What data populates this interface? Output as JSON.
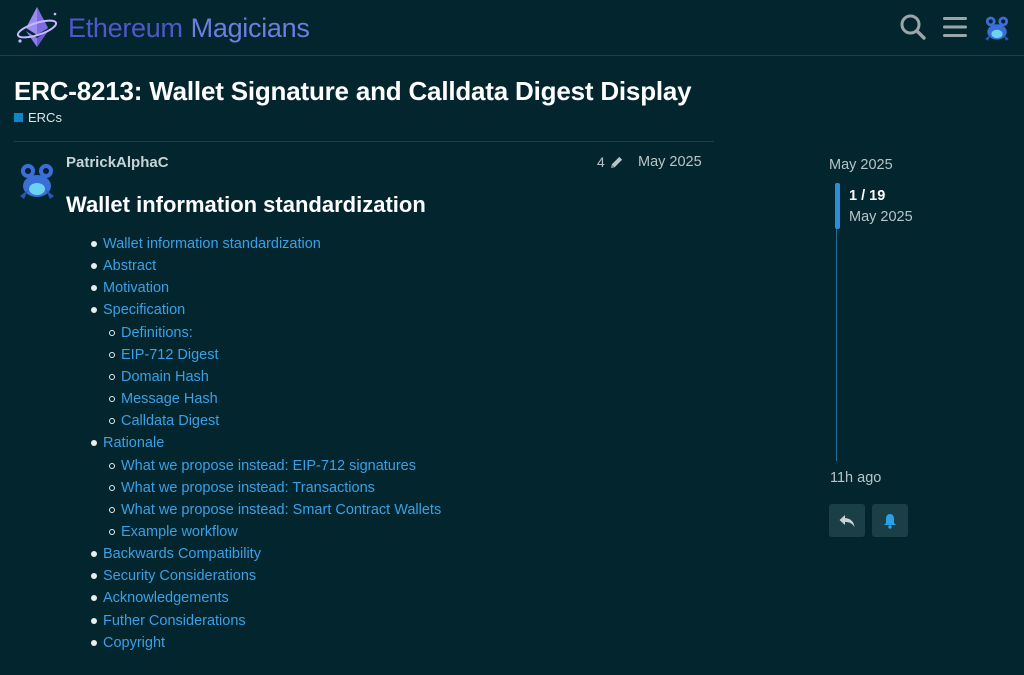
{
  "site": {
    "name_part1": "Ethereum",
    "name_part2": "Magicians"
  },
  "header": {
    "icons": [
      "search-icon",
      "menu-icon",
      "user-avatar"
    ]
  },
  "topic": {
    "title": "ERC-8213: Wallet Signature and Calldata Digest Display",
    "category": "ERCs",
    "category_color": "#0e86c9"
  },
  "post": {
    "author": "PatrickAlphaC",
    "edit_count": "4",
    "date": "May 2025",
    "heading": "Wallet information standardization",
    "toc": [
      {
        "label": "Wallet information standardization",
        "level": 1
      },
      {
        "label": "Abstract",
        "level": 1
      },
      {
        "label": "Motivation",
        "level": 1
      },
      {
        "label": "Specification",
        "level": 1
      },
      {
        "label": "Definitions:",
        "level": 2
      },
      {
        "label": "EIP-712 Digest",
        "level": 2
      },
      {
        "label": "Domain Hash",
        "level": 2
      },
      {
        "label": "Message Hash",
        "level": 2
      },
      {
        "label": "Calldata Digest",
        "level": 2
      },
      {
        "label": "Rationale",
        "level": 1
      },
      {
        "label": "What we propose instead: EIP-712 signatures",
        "level": 2
      },
      {
        "label": "What we propose instead: Transactions",
        "level": 2
      },
      {
        "label": "What we propose instead: Smart Contract Wallets",
        "level": 2
      },
      {
        "label": "Example workflow",
        "level": 2
      },
      {
        "label": "Backwards Compatibility",
        "level": 1
      },
      {
        "label": "Security Considerations",
        "level": 1
      },
      {
        "label": "Acknowledgements",
        "level": 1
      },
      {
        "label": "Futher Considerations",
        "level": 1
      },
      {
        "label": "Copyright",
        "level": 1
      }
    ]
  },
  "timeline": {
    "start_date": "May 2025",
    "position": "1 / 19",
    "position_date": "May 2025",
    "end_label": "11h ago"
  },
  "colors": {
    "background": "#03262e",
    "link": "#3ba0e6",
    "accent": "#2a8fd6"
  }
}
